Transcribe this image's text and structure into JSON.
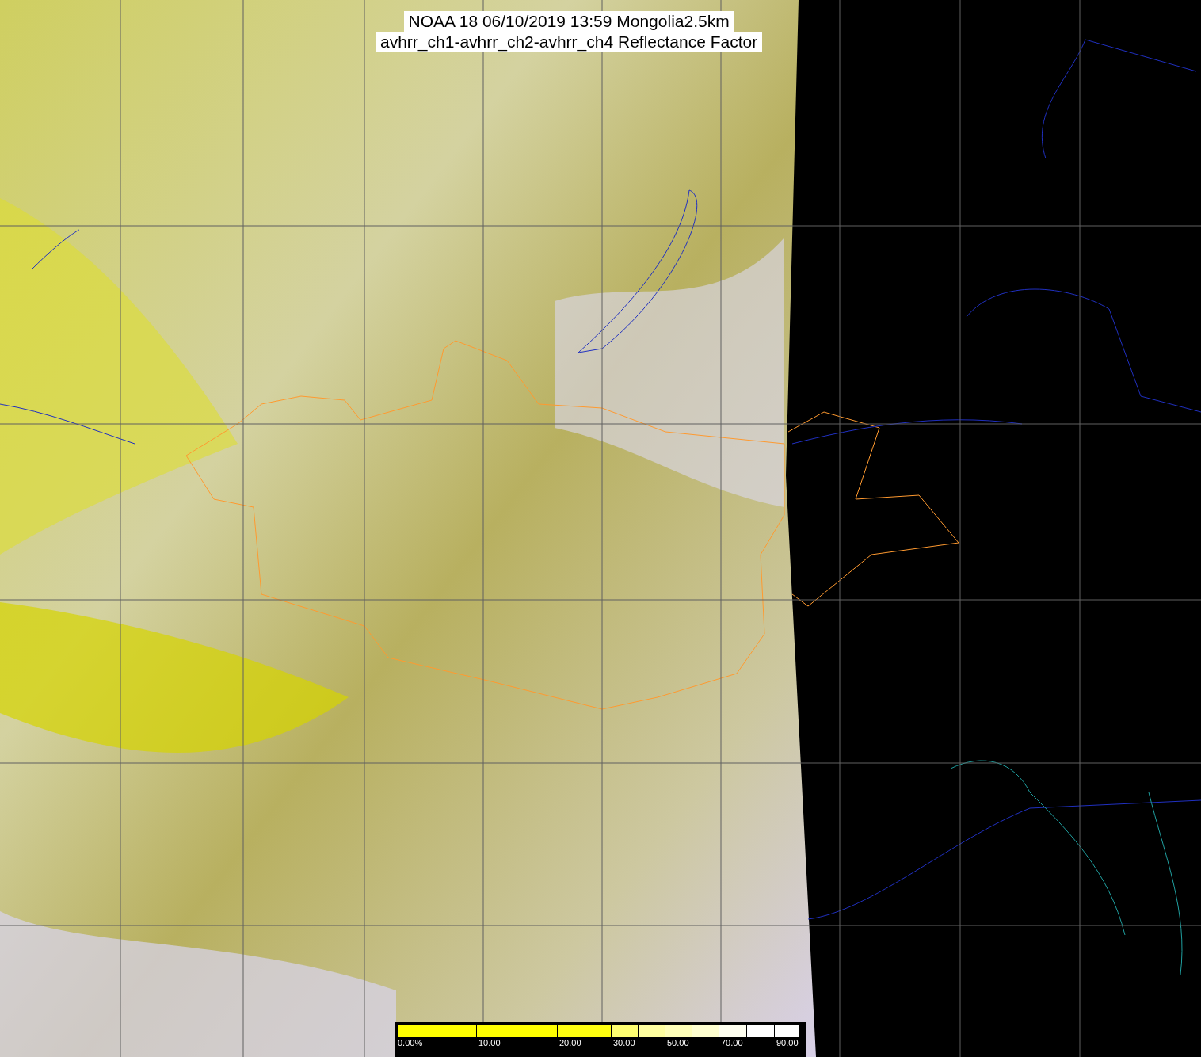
{
  "title": {
    "lines": [
      "NOAA 18 06/10/2019 13:59 Mongolia2.5km",
      "avhrr_ch1-avhrr_ch2-avhrr_ch4 Reflectance Factor"
    ]
  },
  "colorbar": {
    "segments": [
      {
        "color": "#ffff00"
      },
      {
        "color": "#ffff00"
      },
      {
        "color": "#ffff10"
      },
      {
        "color": "#ffff70"
      },
      {
        "color": "#ffffa0"
      },
      {
        "color": "#ffffb8"
      },
      {
        "color": "#ffffd0"
      },
      {
        "color": "#fffff0"
      },
      {
        "color": "#ffffff"
      },
      {
        "color": "#ffffff"
      }
    ],
    "labels": [
      "0.00%",
      "10.00",
      "20.00",
      "30.00",
      "50.00",
      "70.00",
      "90.00"
    ]
  }
}
